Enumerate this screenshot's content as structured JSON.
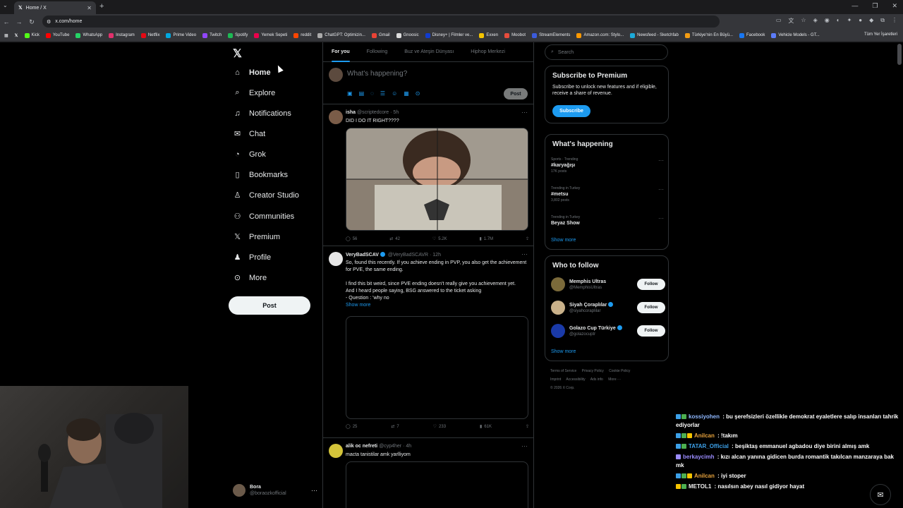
{
  "browser": {
    "tab_title": "Home / X",
    "url": "x.com/home",
    "bookmarks": [
      "Kick",
      "YouTube",
      "WhatsApp",
      "Instagram",
      "Netflix",
      "Prime Video",
      "Twitch",
      "Spotify",
      "Yemek Sepeti",
      "reddit",
      "ChatGPT: Optimizin...",
      "Gmail",
      "Gnoosic",
      "Disney+ | Filmler ve...",
      "Exxen",
      "Moobot",
      "StreamElements",
      "Amazon.com: Stylo...",
      "Newsfeed - Sketchfab",
      "Türkiye'nin En Büyü...",
      "Facebook",
      "Vehicle Models - GT..."
    ],
    "bookmarks_right": "Tüm Yer İşaretleri"
  },
  "nav": {
    "items": [
      {
        "label": "Home",
        "icon": "home-icon"
      },
      {
        "label": "Explore",
        "icon": "search-icon"
      },
      {
        "label": "Notifications",
        "icon": "bell-icon"
      },
      {
        "label": "Chat",
        "icon": "mail-icon"
      },
      {
        "label": "Grok",
        "icon": "grok-icon"
      },
      {
        "label": "Bookmarks",
        "icon": "bookmark-icon"
      },
      {
        "label": "Creator Studio",
        "icon": "creator-icon"
      },
      {
        "label": "Communities",
        "icon": "communities-icon"
      },
      {
        "label": "Premium",
        "icon": "x-icon"
      },
      {
        "label": "Profile",
        "icon": "profile-icon"
      },
      {
        "label": "More",
        "icon": "more-icon"
      }
    ],
    "post_label": "Post",
    "account_name": "Bora",
    "account_handle": "@boraozkofficial"
  },
  "timeline": {
    "tabs": [
      "For you",
      "Following",
      "Buz ve Ateşin Dünyası",
      "Hiphop Merkezi"
    ],
    "composer_placeholder": "What's happening?",
    "composer_post": "Post",
    "tweets": [
      {
        "name": "isha",
        "handle": "@scriptedcore · 5h",
        "text": "DID I DO IT RIGHT????",
        "replies": "56",
        "reposts": "42",
        "likes": "5.2K",
        "views": "1.7M"
      },
      {
        "name": "VeryBadSCAV",
        "handle": "@VeryBadSCAVR · 12h",
        "line1": "So, found this recently. If you achieve ending in PVP, you also get the achievement for PVE, the same ending.",
        "line2": "I find this bit weird, since PVE ending doesn't really give you achievement yet.",
        "line3": "And I heard people saying, BSG answered to the ticket asking",
        "line4": "- Question : 'why no",
        "show_more": "Show more",
        "replies": "25",
        "reposts": "7",
        "likes": "233",
        "views": "61K"
      },
      {
        "name": "alik oc nefreti",
        "handle": "@cyp4her · 4h",
        "text": "macta tanistilar amk yarlliyom"
      }
    ]
  },
  "sidebar": {
    "search_placeholder": "Search",
    "premium": {
      "title": "Subscribe to Premium",
      "text": "Subscribe to unlock new features and if eligible, receive a share of revenue.",
      "button": "Subscribe"
    },
    "happening": {
      "title": "What's happening",
      "trends": [
        {
          "category": "Sports · Trending",
          "title": "#karyağışı",
          "count": "17K posts"
        },
        {
          "category": "Trending in Turkey",
          "title": "#metsu",
          "count": "3,802 posts"
        },
        {
          "category": "Trending in Turkey",
          "title": "Beyaz Show",
          "count": ""
        }
      ],
      "show_more": "Show more"
    },
    "who_to_follow": {
      "title": "Who to follow",
      "accounts": [
        {
          "name": "Memphis Ultras",
          "handle": "@MemphisUltras",
          "button": "Follow"
        },
        {
          "name": "Siyah Çoraplılar",
          "handle": "@siyahcoraplilar",
          "button": "Follow"
        },
        {
          "name": "Golazo Cup Türkiye",
          "handle": "@golazocuptr",
          "button": "Follow"
        }
      ],
      "show_more": "Show more"
    },
    "footer": [
      "Terms of Service",
      "Privacy Policy",
      "Cookie Policy",
      "Imprint",
      "Accessibility",
      "Ads info",
      "More ···",
      "© 2026 X Corp."
    ]
  },
  "chat": [
    {
      "user": "kossiyohen",
      "text": " : bu şerefsizleri özellikle demokrat eyaletlere salıp insanları tahrik ediyorlar",
      "color": "#8fb8ff"
    },
    {
      "user": "Anilcan",
      "text": " : !takım",
      "color": "#e8a33c"
    },
    {
      "user": "TATAR_Official",
      "text": " : beşiktaş emmanuel agbadou diye birini almış amk",
      "color": "#3ca0e8"
    },
    {
      "user": "berkaycimh",
      "text": " : kızı alcan yanına gidicen burda romantik takılcan manzaraya bak mk",
      "color": "#9b8cff"
    },
    {
      "user": "Anilcan",
      "text": " : iyi stoper",
      "color": "#e8a33c"
    },
    {
      "user": "METOL1",
      "text": " : nasılsın abey nasıl gidiyor hayat",
      "color": "#f0f0f0"
    }
  ]
}
